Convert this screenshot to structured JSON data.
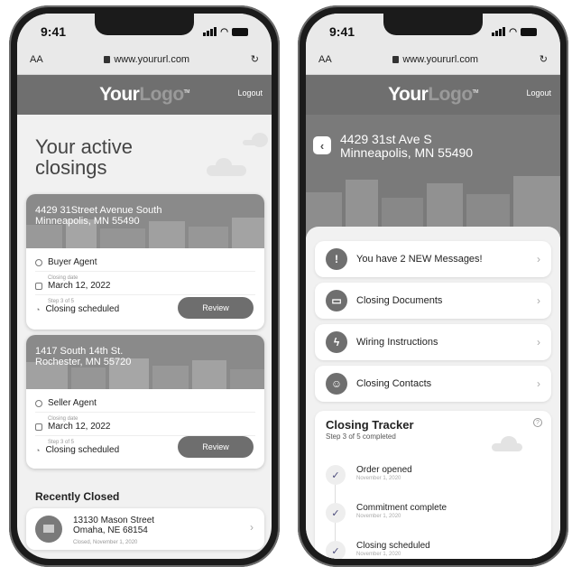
{
  "left_phone": {
    "status": {
      "time": "9:41"
    },
    "browser": {
      "text_size": "AA",
      "url": "www.yoururl.com",
      "reload": "↻"
    },
    "header": {
      "logo_a": "Your",
      "logo_b": "Logo",
      "logo_tm": "TM",
      "logout": "Logout"
    },
    "hero_title": "Your active closings",
    "cards": [
      {
        "address_line1": "4429 31Street Avenue South",
        "address_line2": "Minneapolis, MN 55490",
        "role": "Buyer Agent",
        "date_caption": "Closing date",
        "date": "March 12, 2022",
        "step_caption": "Step 3 of 5",
        "status": "Closing scheduled",
        "button": "Review"
      },
      {
        "address_line1": "1417 South 14th St.",
        "address_line2": "Rochester, MN 55720",
        "role": "Seller Agent",
        "date_caption": "Closing date",
        "date": "March 12, 2022",
        "step_caption": "Step 3 of 5",
        "status": "Closing scheduled",
        "button": "Review"
      }
    ],
    "recently_closed": {
      "title": "Recently Closed",
      "item": {
        "line1": "13130 Mason Street",
        "line2": "Omaha, NE 68154",
        "date": "Closed, November 1, 2020"
      }
    }
  },
  "right_phone": {
    "status": {
      "time": "9:41"
    },
    "browser": {
      "text_size": "AA",
      "url": "www.yoururl.com",
      "reload": "↻"
    },
    "header": {
      "logo_a": "Your",
      "logo_b": "Logo",
      "logo_tm": "TM",
      "logout": "Logout"
    },
    "address_line1": "4429 31st Ave S",
    "address_line2": "Minneapolis, MN 55490",
    "menu": [
      {
        "label": "You have 2 NEW Messages!",
        "icon": "alert-icon"
      },
      {
        "label": "Closing Documents",
        "icon": "folder-icon"
      },
      {
        "label": "Wiring Instructions",
        "icon": "lightning-icon"
      },
      {
        "label": "Closing Contacts",
        "icon": "contacts-icon"
      }
    ],
    "tracker": {
      "title": "Closing Tracker",
      "subtitle": "Step 3 of 5 completed",
      "help": "?",
      "steps": [
        {
          "label": "Order opened",
          "date": "November 1, 2020"
        },
        {
          "label": "Commitment complete",
          "date": "November 1, 2020"
        },
        {
          "label": "Closing scheduled",
          "date": "November 1, 2020"
        }
      ]
    }
  },
  "colors": {
    "header_bg": "#6f6f6f",
    "button_bg": "#6e6e6e",
    "logo_accent": "#9a9a9a",
    "page_bg": "#f1f1f1"
  }
}
